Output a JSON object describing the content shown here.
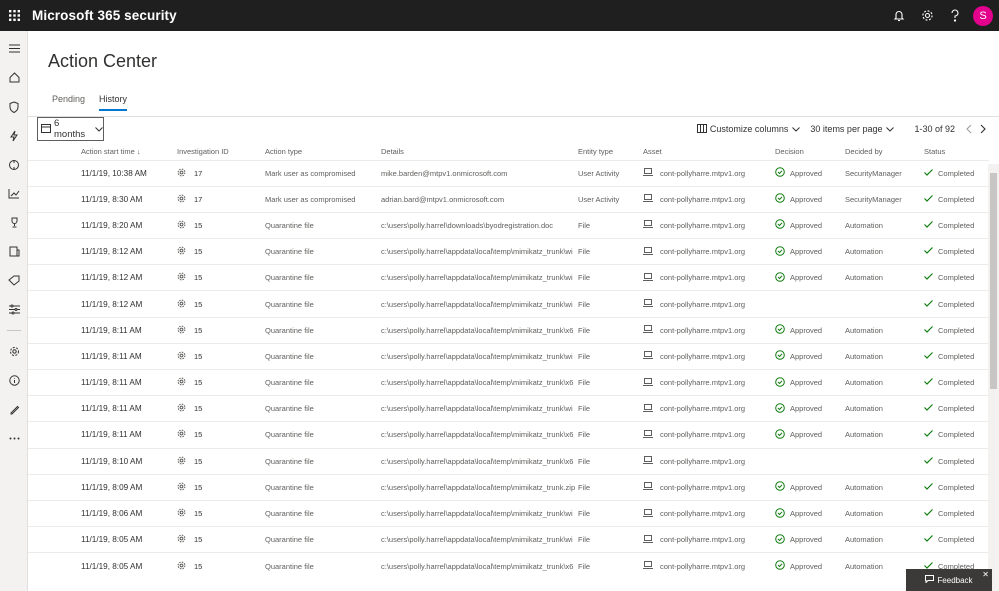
{
  "app": {
    "title": "Microsoft 365 security",
    "avatar_initial": "S"
  },
  "topbar_icons": [
    "bell-icon",
    "gear-icon",
    "help-icon"
  ],
  "sidebar_icons": [
    "menu-icon",
    "home-icon",
    "shield-icon",
    "incidents-icon",
    "hunting-icon",
    "reports-icon",
    "trophy-icon",
    "devices-icon",
    "tag-icon",
    "settings-sliders-icon",
    "gear-icon",
    "info-icon",
    "pencil-icon",
    "more-icon"
  ],
  "page": {
    "title": "Action Center"
  },
  "tabs": [
    {
      "label": "Pending"
    },
    {
      "label": "History"
    }
  ],
  "filter": {
    "value": "6 months"
  },
  "toolbar": {
    "customize": "Customize columns",
    "per_page": "30 items per page",
    "range": "1-30 of 92"
  },
  "columns": [
    "Action start time",
    "Investigation ID",
    "Action type",
    "Details",
    "Entity type",
    "Asset",
    "Decision",
    "Decided by",
    "Status"
  ],
  "rows": [
    {
      "time": "11/1/19, 10:38 AM",
      "id": "17",
      "action": "Mark user as compromised",
      "details": "mike.barden@mtpv1.onmicrosoft.com",
      "entity": "User Activity",
      "asset": "cont-pollyharre.mtpv1.org",
      "decision": "Approved",
      "by": "SecurityManager",
      "status": "Completed"
    },
    {
      "time": "11/1/19, 8:30 AM",
      "id": "17",
      "action": "Mark user as compromised",
      "details": "adrian.bard@mtpv1.onmicrosoft.com",
      "entity": "User Activity",
      "asset": "cont-pollyharre.mtpv1.org",
      "decision": "Approved",
      "by": "SecurityManager",
      "status": "Completed"
    },
    {
      "time": "11/1/19, 8:20 AM",
      "id": "15",
      "action": "Quarantine file",
      "details": "c:\\users\\polly.harrel\\downloads\\byodregistration.doc",
      "entity": "File",
      "asset": "cont-pollyharre.mtpv1.org",
      "decision": "Approved",
      "by": "Automation",
      "status": "Completed"
    },
    {
      "time": "11/1/19, 8:12 AM",
      "id": "15",
      "action": "Quarantine file",
      "details": "c:\\users\\polly.harrel\\appdata\\local\\temp\\mimikatz_trunk\\wi",
      "entity": "File",
      "asset": "cont-pollyharre.mtpv1.org",
      "decision": "Approved",
      "by": "Automation",
      "status": "Completed"
    },
    {
      "time": "11/1/19, 8:12 AM",
      "id": "15",
      "action": "Quarantine file",
      "details": "c:\\users\\polly.harrel\\appdata\\local\\temp\\mimikatz_trunk\\wi",
      "entity": "File",
      "asset": "cont-pollyharre.mtpv1.org",
      "decision": "Approved",
      "by": "Automation",
      "status": "Completed"
    },
    {
      "time": "11/1/19, 8:12 AM",
      "id": "15",
      "action": "Quarantine file",
      "details": "c:\\users\\polly.harrel\\appdata\\local\\temp\\mimikatz_trunk\\wi",
      "entity": "File",
      "asset": "cont-pollyharre.mtpv1.org",
      "decision": "",
      "by": "",
      "status": "Completed"
    },
    {
      "time": "11/1/19, 8:11 AM",
      "id": "15",
      "action": "Quarantine file",
      "details": "c:\\users\\polly.harrel\\appdata\\local\\temp\\mimikatz_trunk\\x6",
      "entity": "File",
      "asset": "cont-pollyharre.mtpv1.org",
      "decision": "Approved",
      "by": "Automation",
      "status": "Completed"
    },
    {
      "time": "11/1/19, 8:11 AM",
      "id": "15",
      "action": "Quarantine file",
      "details": "c:\\users\\polly.harrel\\appdata\\local\\temp\\mimikatz_trunk\\wi",
      "entity": "File",
      "asset": "cont-pollyharre.mtpv1.org",
      "decision": "Approved",
      "by": "Automation",
      "status": "Completed"
    },
    {
      "time": "11/1/19, 8:11 AM",
      "id": "15",
      "action": "Quarantine file",
      "details": "c:\\users\\polly.harrel\\appdata\\local\\temp\\mimikatz_trunk\\x6",
      "entity": "File",
      "asset": "cont-pollyharre.mtpv1.org",
      "decision": "Approved",
      "by": "Automation",
      "status": "Completed"
    },
    {
      "time": "11/1/19, 8:11 AM",
      "id": "15",
      "action": "Quarantine file",
      "details": "c:\\users\\polly.harrel\\appdata\\local\\temp\\mimikatz_trunk\\wi",
      "entity": "File",
      "asset": "cont-pollyharre.mtpv1.org",
      "decision": "Approved",
      "by": "Automation",
      "status": "Completed"
    },
    {
      "time": "11/1/19, 8:11 AM",
      "id": "15",
      "action": "Quarantine file",
      "details": "c:\\users\\polly.harrel\\appdata\\local\\temp\\mimikatz_trunk\\x6",
      "entity": "File",
      "asset": "cont-pollyharre.mtpv1.org",
      "decision": "Approved",
      "by": "Automation",
      "status": "Completed"
    },
    {
      "time": "11/1/19, 8:10 AM",
      "id": "15",
      "action": "Quarantine file",
      "details": "c:\\users\\polly.harrel\\appdata\\local\\temp\\mimikatz_trunk\\x6",
      "entity": "File",
      "asset": "cont-pollyharre.mtpv1.org",
      "decision": "",
      "by": "",
      "status": "Completed"
    },
    {
      "time": "11/1/19, 8:09 AM",
      "id": "15",
      "action": "Quarantine file",
      "details": "c:\\users\\polly.harrel\\appdata\\local\\temp\\mimikatz_trunk.zip",
      "entity": "File",
      "asset": "cont-pollyharre.mtpv1.org",
      "decision": "Approved",
      "by": "Automation",
      "status": "Completed"
    },
    {
      "time": "11/1/19, 8:06 AM",
      "id": "15",
      "action": "Quarantine file",
      "details": "c:\\users\\polly.harrel\\appdata\\local\\temp\\mimikatz_trunk\\wi",
      "entity": "File",
      "asset": "cont-pollyharre.mtpv1.org",
      "decision": "Approved",
      "by": "Automation",
      "status": "Completed"
    },
    {
      "time": "11/1/19, 8:05 AM",
      "id": "15",
      "action": "Quarantine file",
      "details": "c:\\users\\polly.harrel\\appdata\\local\\temp\\mimikatz_trunk\\wi",
      "entity": "File",
      "asset": "cont-pollyharre.mtpv1.org",
      "decision": "Approved",
      "by": "Automation",
      "status": "Completed"
    },
    {
      "time": "11/1/19, 8:05 AM",
      "id": "15",
      "action": "Quarantine file",
      "details": "c:\\users\\polly.harrel\\appdata\\local\\temp\\mimikatz_trunk\\x6",
      "entity": "File",
      "asset": "cont-pollyharre.mtpv1.org",
      "decision": "Approved",
      "by": "Automation",
      "status": "Completed"
    }
  ],
  "feedback": {
    "label": "Feedback"
  },
  "colors": {
    "topbar": "#1f1f1f",
    "accent": "#0078d4",
    "avatar": "#e3008c",
    "success": "#107c10"
  }
}
